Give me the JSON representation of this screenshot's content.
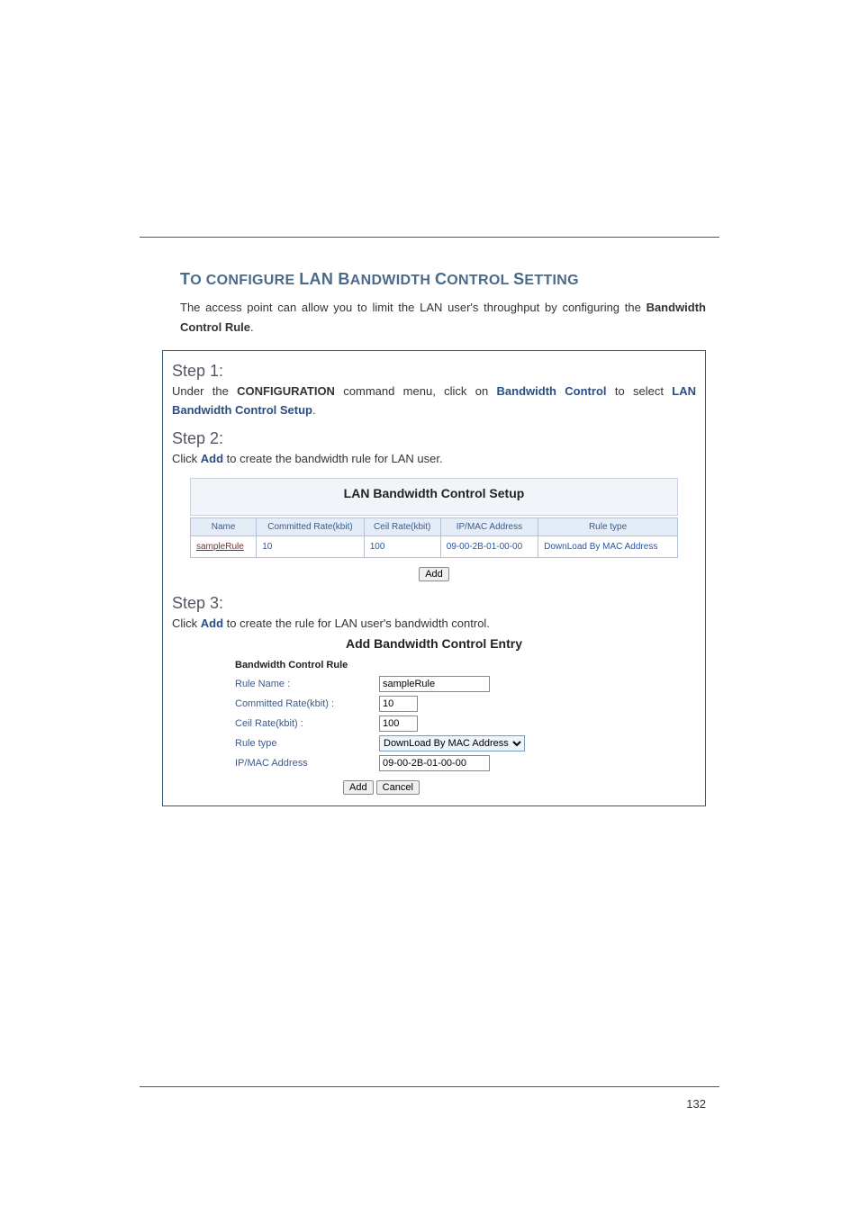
{
  "page_number": "132",
  "heading_html": "T",
  "heading_full": "To configure LAN Bandwidth Control Setting",
  "heading_parts": {
    "t": "T",
    "o": "O",
    " ": " ",
    "c": "C",
    "onfigure": "ONFIGURE",
    "lan": "LAN",
    "b": "B",
    "andwidth": "ANDWIDTH",
    "ontrol": "ONTROL",
    "s": "S",
    "etting": "ETTING"
  },
  "intro": {
    "pre": "The access point can allow you to limit the LAN user's throughput by configuring the ",
    "bold": "Bandwidth Control Rule",
    "post": "."
  },
  "step1": {
    "label": "Step 1:",
    "pre": "Under the ",
    "b1": "CONFIGURATION",
    "mid": " command menu, click on ",
    "b2": "Bandwidth Control",
    "mid2": " to select ",
    "link": "LAN Bandwidth Control Setup",
    "post": "."
  },
  "step2": {
    "label": "Step 2:",
    "pre": "Click ",
    "b1": "Add",
    "post": " to create the bandwidth rule for LAN user."
  },
  "lan_panel": {
    "title": "LAN Bandwidth Control Setup",
    "headers": [
      "Name",
      "Committed Rate(kbit)",
      "Ceil Rate(kbit)",
      "IP/MAC Address",
      "Rule type"
    ],
    "row": {
      "name": "sampleRule",
      "committed": "10",
      "ceil": "100",
      "ipmac": "09-00-2B-01-00-00",
      "ruletype": "DownLoad By MAC Address"
    },
    "add_btn": "Add"
  },
  "step3": {
    "label": "Step 3:",
    "pre": "Click ",
    "b1": "Add",
    "post": " to create the rule for LAN user's bandwidth control."
  },
  "entry": {
    "title": "Add Bandwidth Control Entry",
    "subhead": "Bandwidth Control Rule",
    "labels": {
      "rule_name": "Rule Name :",
      "committed": "Committed Rate(kbit) :",
      "ceil": "Ceil Rate(kbit) :",
      "rule_type": "Rule type",
      "ipmac": "IP/MAC Address"
    },
    "values": {
      "rule_name": "sampleRule",
      "committed": "10",
      "ceil": "100",
      "rule_type": "DownLoad By MAC Address",
      "ipmac": "09-00-2B-01-00-00"
    },
    "add_btn": "Add",
    "cancel_btn": "Cancel"
  }
}
